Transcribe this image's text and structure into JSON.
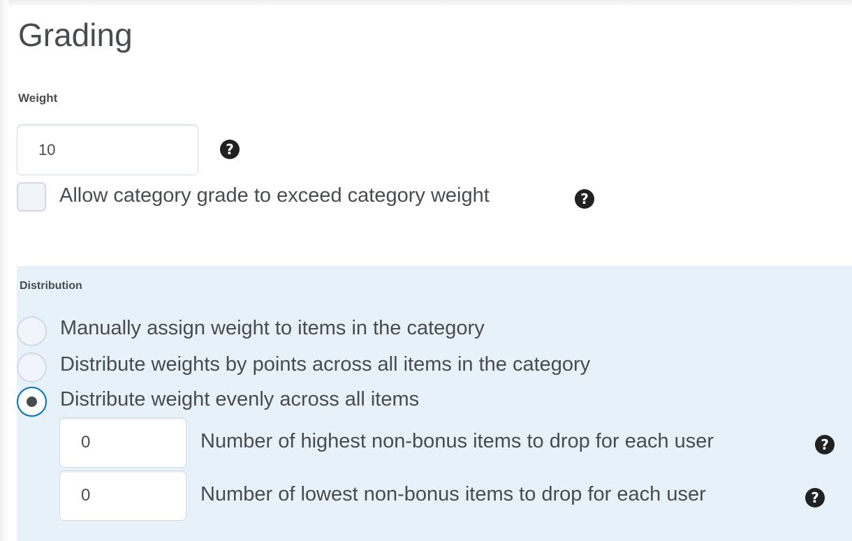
{
  "page": {
    "title": "Grading"
  },
  "weight": {
    "label": "Weight",
    "value": "10",
    "help_icon": "question-circle-icon"
  },
  "exceed": {
    "label": "Allow category grade to exceed category weight",
    "checked": false,
    "help_icon": "question-circle-icon"
  },
  "distribution": {
    "label": "Distribution",
    "options": [
      {
        "label": "Manually assign weight to items in the category",
        "selected": false
      },
      {
        "label": "Distribute weights by points across all items in the category",
        "selected": false
      },
      {
        "label": "Distribute weight evenly across all items",
        "selected": true
      }
    ],
    "drop_highest": {
      "value": "0",
      "label": "Number of highest non-bonus items to drop for each user",
      "help_icon": "question-circle-icon"
    },
    "drop_lowest": {
      "value": "0",
      "label": "Number of lowest non-bonus items to drop for each user",
      "help_icon": "question-circle-icon"
    }
  },
  "colors": {
    "text": "#494c4e",
    "panel_background": "#e6f1f9",
    "input_border": "#d3d9e3",
    "focus_blue": "#006fbf",
    "help_icon": "#202122"
  }
}
